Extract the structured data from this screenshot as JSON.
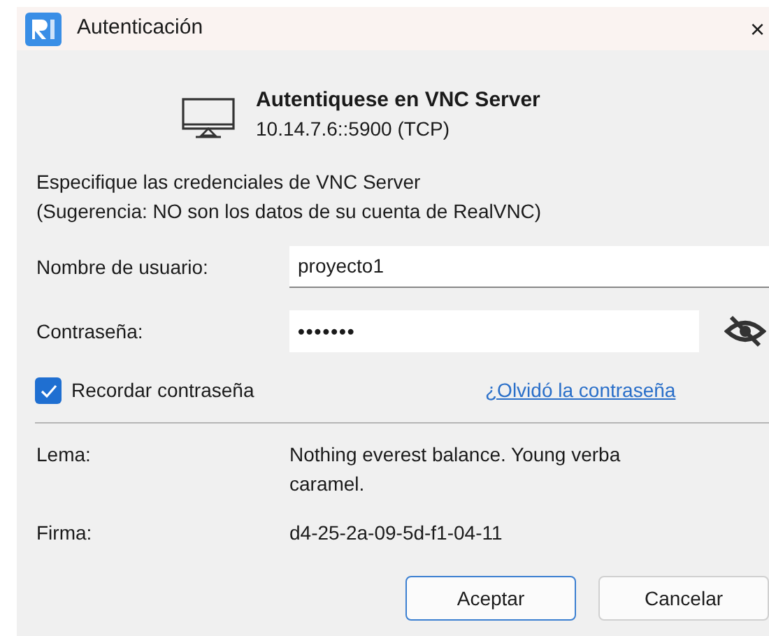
{
  "window": {
    "title": "Autenticación",
    "close": "×"
  },
  "header": {
    "title": "Autentiquese en VNC Server",
    "address": "10.14.7.6::5900 (TCP)"
  },
  "instructions": [
    "Especifique las credenciales de VNC Server",
    "(Sugerencia: NO son los datos de su cuenta de RealVNC)"
  ],
  "username": {
    "label": "Nombre de usuario:",
    "value": "proyecto1"
  },
  "password": {
    "label": "Contraseña:",
    "value": "•••••••",
    "hidden": true
  },
  "remember": {
    "label": "Recordar contraseña",
    "checked": true
  },
  "forgot_link": "¿Olvidó la contraseña",
  "details": [
    {
      "label": "Lema:",
      "value": "Nothing everest balance. Young verba\ncaramel."
    },
    {
      "label": "Firma:",
      "value": "d4-25-2a-09-5d-f1-04-11"
    }
  ],
  "buttons": [
    {
      "label": "Aceptar",
      "default": true
    },
    {
      "label": "Cancelar",
      "default": false
    }
  ]
}
